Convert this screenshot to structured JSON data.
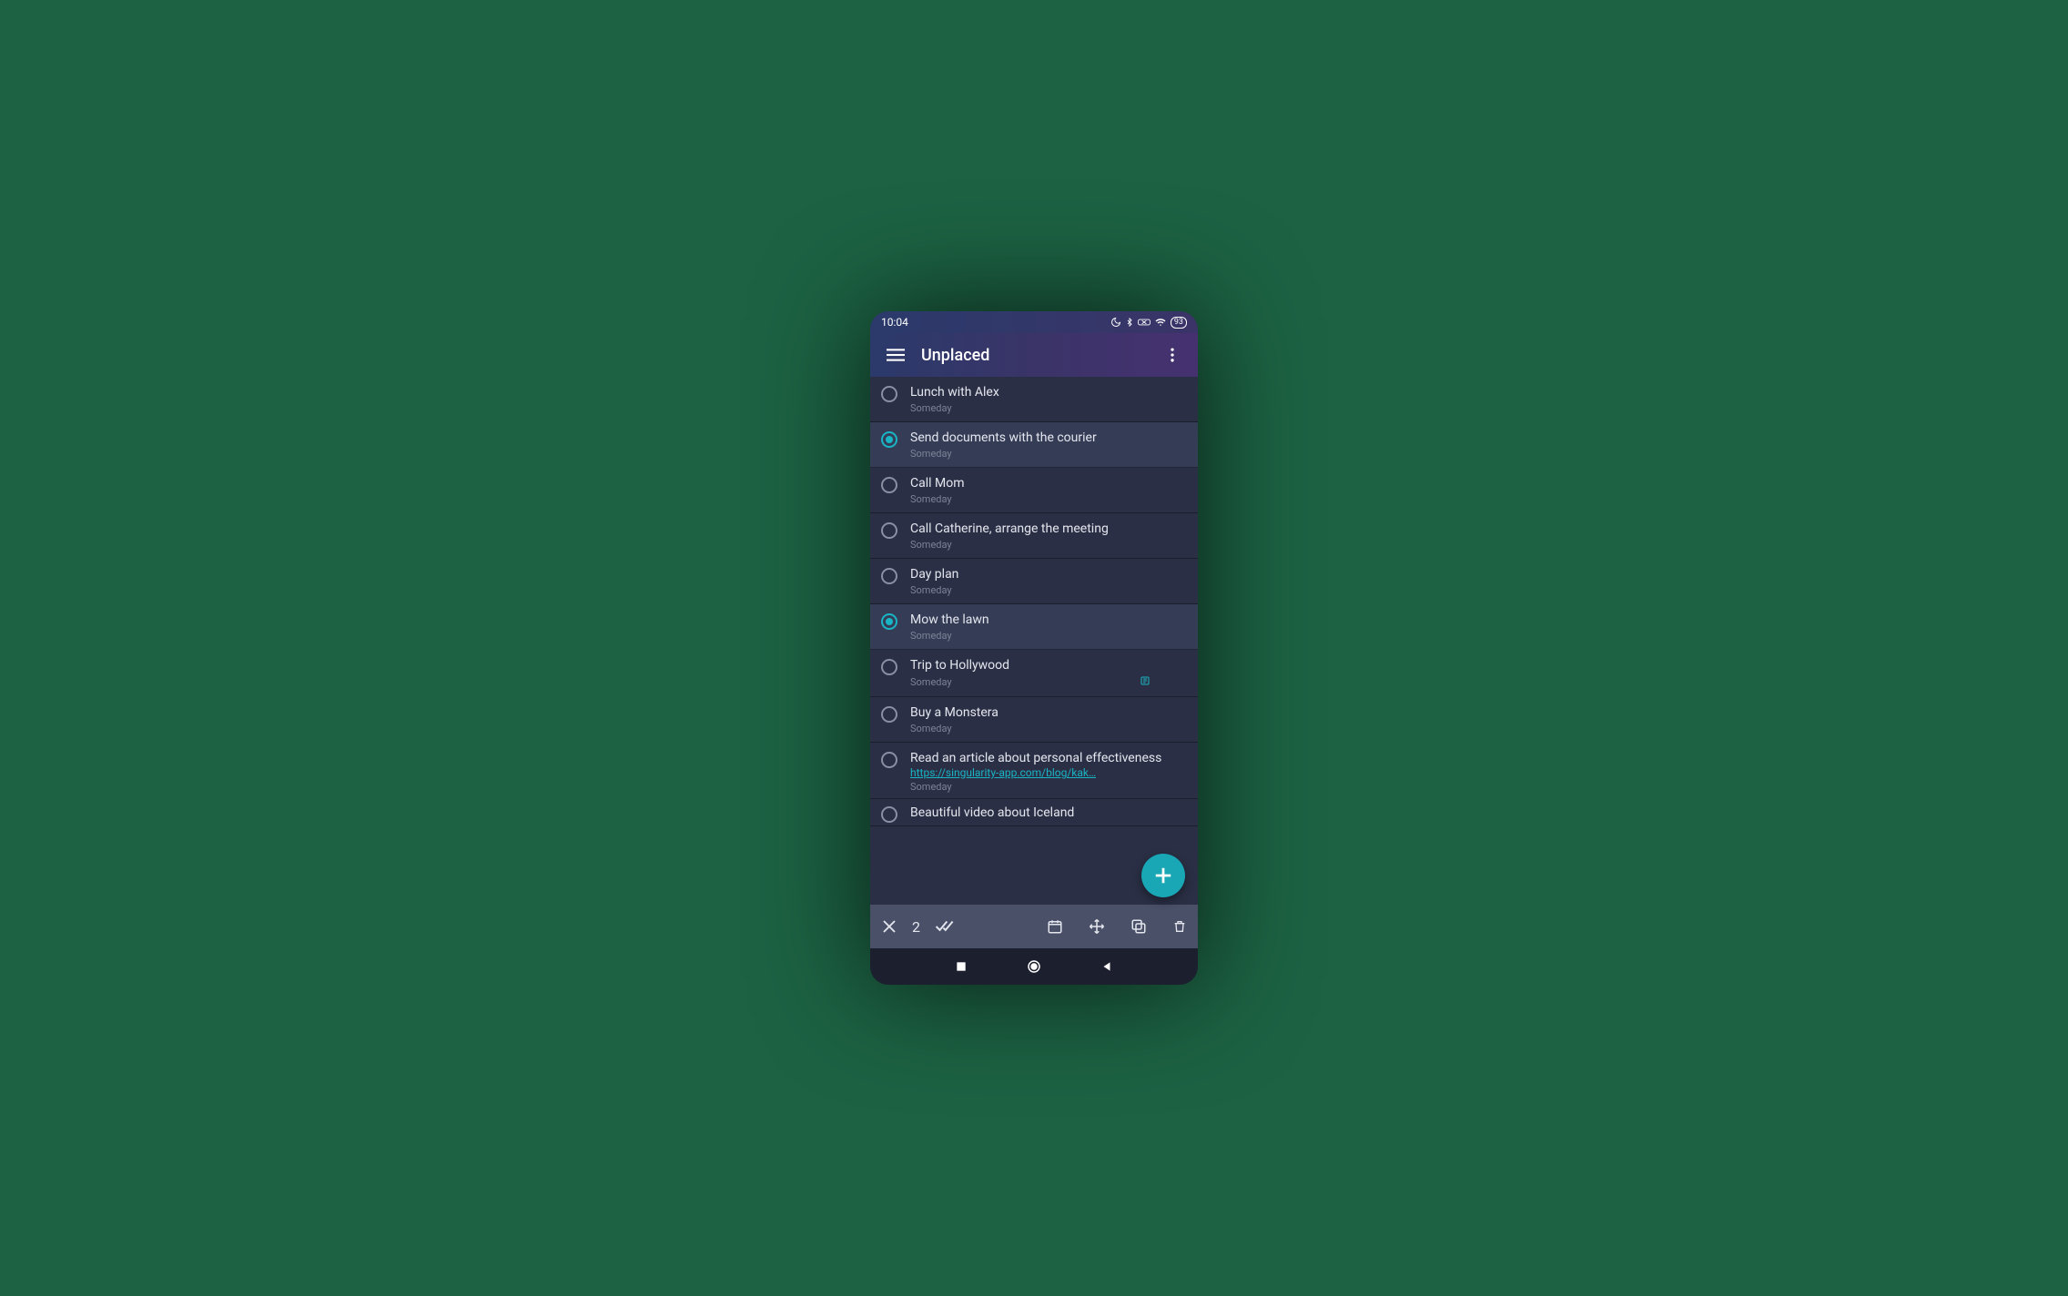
{
  "status": {
    "time": "10:04",
    "battery": "93"
  },
  "appbar": {
    "title": "Unplaced"
  },
  "tasks": [
    {
      "title": "Lunch with Alex",
      "sub": "Someday",
      "selected": false
    },
    {
      "title": "Send documents with the courier",
      "sub": "Someday",
      "selected": true
    },
    {
      "title": "Call Mom",
      "sub": "Someday",
      "selected": false
    },
    {
      "title": "Call Catherine, arrange the meeting",
      "sub": "Someday",
      "selected": false
    },
    {
      "title": "Day plan",
      "sub": "Someday",
      "selected": false
    },
    {
      "title": "Mow the lawn",
      "sub": "Someday",
      "selected": true
    },
    {
      "title": "Trip to Hollywood",
      "sub": "Someday",
      "selected": false,
      "has_note": true
    },
    {
      "title": "Buy a Monstera",
      "sub": "Someday",
      "selected": false
    },
    {
      "title": "Read an article about personal effectiveness",
      "sub": "Someday",
      "selected": false,
      "link": "https://singularity-app.com/blog/kak…"
    },
    {
      "title": "Beautiful video about Iceland",
      "sub": "",
      "selected": false
    }
  ],
  "actionbar": {
    "selected_count": "2"
  }
}
